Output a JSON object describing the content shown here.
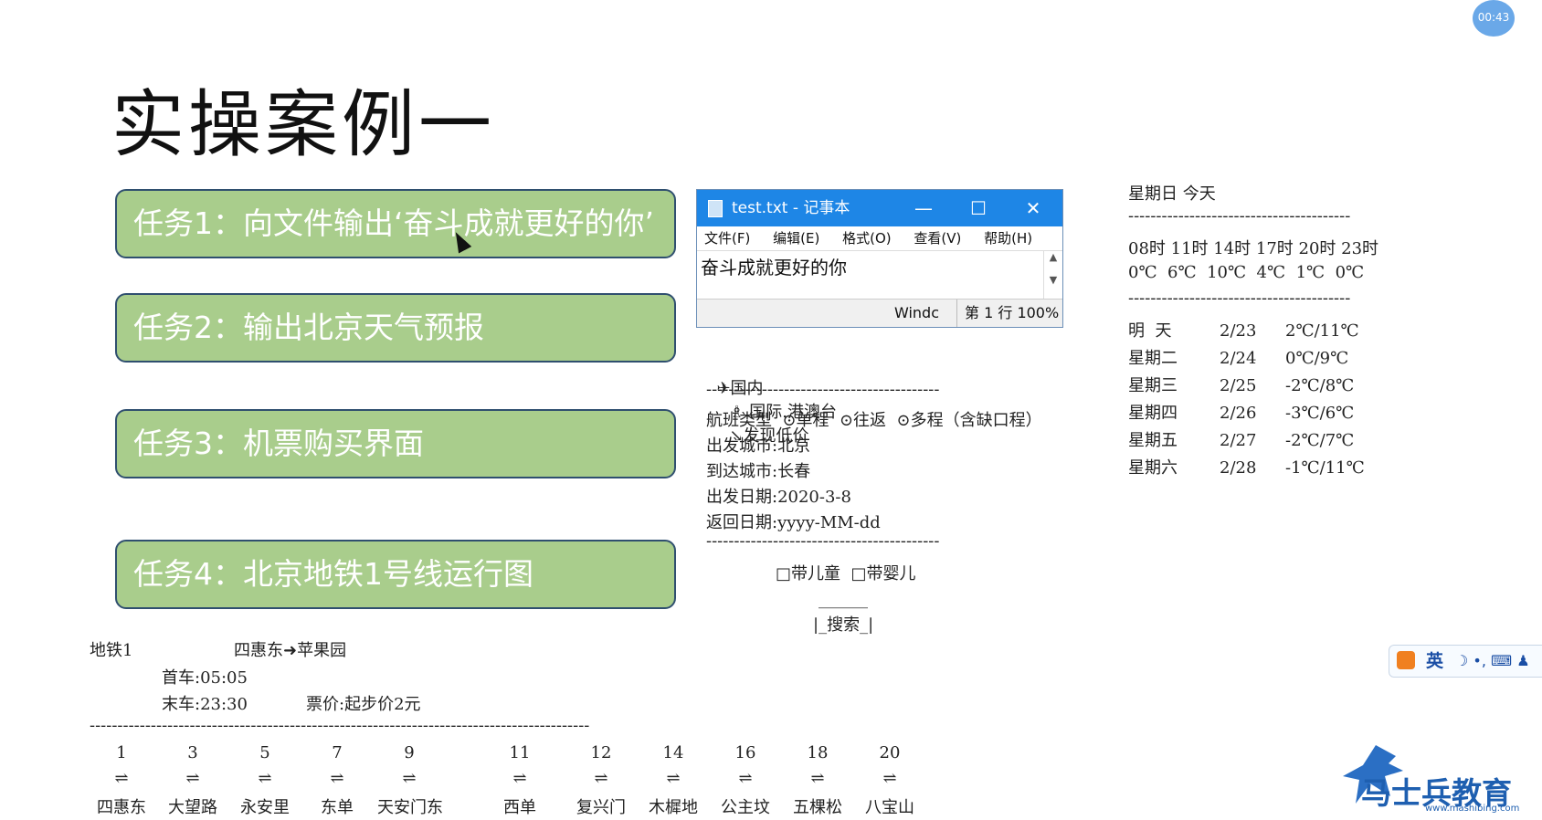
{
  "header": {
    "title": "实操案例一",
    "timer": "00:43"
  },
  "tasks": [
    "任务1：向文件输出‘奋斗成就更好的你’",
    "任务2：输出北京天气预报",
    "任务3：机票购买界面",
    "任务4：北京地铁1号线运行图"
  ],
  "notepad": {
    "title": "test.txt - 记事本",
    "minimize": "—",
    "maximize": "☐",
    "close": "✕",
    "menu": [
      "文件(F)",
      "编辑(E)",
      "格式(O)",
      "查看(V)",
      "帮助(H)"
    ],
    "content": "奋斗成就更好的你",
    "status_encoding": "Windc",
    "status_position": "第 1 行 100%"
  },
  "flight": {
    "tabs": [
      "✈国内",
      "♗ 国际.港澳台",
      "↘发现低价"
    ],
    "divider": "------------------------------------------",
    "type_line": "航班类型  ⊙单程  ⊙往返  ⊙多程（含缺口程）",
    "depart_city": "出发城市:北京",
    "arrive_city": "到达城市:长春",
    "depart_date": "出发日期:2020-3-8",
    "return_date": "返回日期:yyyy-MM-dd",
    "divider2": "------------------------------------------",
    "options": "□带儿童  □带婴儿",
    "search_top": "______",
    "search_btn": "|_搜索_|"
  },
  "weather": {
    "header": "星期日 今天",
    "divider": "----------------------------------------",
    "hours": "08时 11时 14时 17时 20时 23时",
    "temps": "0℃  6℃  10℃  4℃  1℃  0℃",
    "divider2": "----------------------------------------",
    "days": [
      {
        "day": "明  天",
        "date": "2/23",
        "range": "2℃/11℃"
      },
      {
        "day": "星期二",
        "date": "2/24",
        "range": "0℃/9℃"
      },
      {
        "day": "星期三",
        "date": "2/25",
        "range": "-2℃/8℃"
      },
      {
        "day": "星期四",
        "date": "2/26",
        "range": "-3℃/6℃"
      },
      {
        "day": "星期五",
        "date": "2/27",
        "range": "-2℃/7℃"
      },
      {
        "day": "星期六",
        "date": "2/28",
        "range": "-1℃/11℃"
      }
    ]
  },
  "subway": {
    "line": "地铁1",
    "route": "四惠东➜苹果园",
    "first": "首车:05:05",
    "last": "末车:23:30",
    "price": "票价:起步价2元",
    "divider": "------------------------------------------------------------------------------------------",
    "arrow": "⇌",
    "stations": [
      {
        "num": "1",
        "name": "四惠东"
      },
      {
        "num": "3",
        "name": "大望路"
      },
      {
        "num": "5",
        "name": "永安里"
      },
      {
        "num": "7",
        "name": "东单"
      },
      {
        "num": "9",
        "name": "天安门东"
      },
      {
        "num": "11",
        "name": "西单"
      },
      {
        "num": "12",
        "name": "复兴门"
      },
      {
        "num": "14",
        "name": "木樨地"
      },
      {
        "num": "16",
        "name": "公主坟"
      },
      {
        "num": "18",
        "name": "五棵松"
      },
      {
        "num": "20",
        "name": "八宝山"
      }
    ]
  },
  "ime": {
    "lang": "英",
    "items": "☽ •, ⌨ ♟"
  },
  "brand": {
    "name": "马士兵教育",
    "url": "www.mashibing.com"
  }
}
